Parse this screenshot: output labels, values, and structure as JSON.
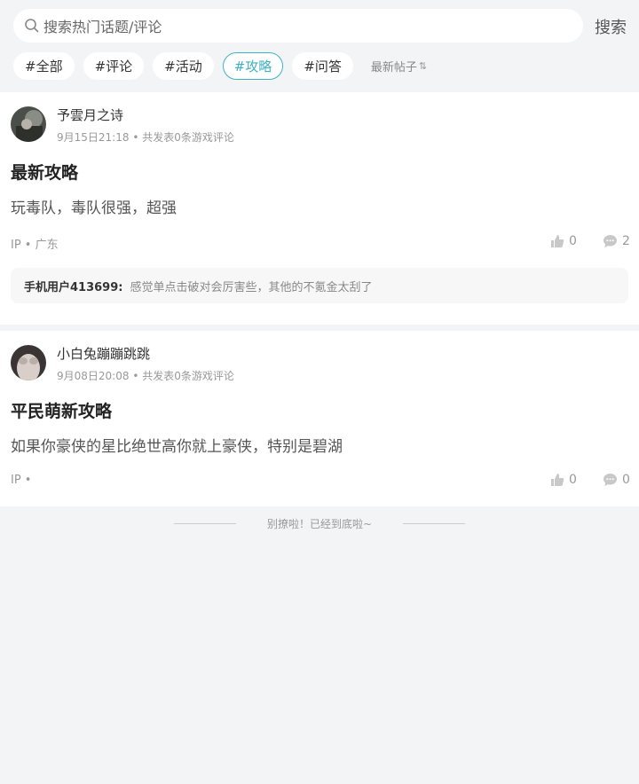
{
  "search": {
    "placeholder": "搜索热门话题/评论",
    "button": "搜索"
  },
  "tags": [
    {
      "label": "#全部"
    },
    {
      "label": "#评论"
    },
    {
      "label": "#活动"
    },
    {
      "label": "#攻略",
      "active": true
    },
    {
      "label": "#问答"
    }
  ],
  "sort": {
    "label": "最新帖子",
    "icon": "sort-arrows-icon"
  },
  "posts": [
    {
      "author": "予雲月之诗",
      "date": "9月15日21:18",
      "info": "共发表0条游戏评论",
      "title": "最新攻略",
      "content": "玩毒队，毒队很强，超强",
      "ip": "IP • 广东",
      "likes": "0",
      "comments": "2",
      "reply": {
        "user": "手机用户413699:",
        "text": "感觉单点击破对会厉害些，其他的不氪金太刮了"
      }
    },
    {
      "author": "小白兔蹦蹦跳跳",
      "date": "9月08日20:08",
      "info": "共发表0条游戏评论",
      "title": "平民萌新攻略",
      "content": "如果你豪侠的星比绝世高你就上豪侠，特别是碧湖",
      "ip": "IP •",
      "likes": "0",
      "comments": "0"
    }
  ],
  "footer": {
    "text": "别撩啦！已经到底啦~"
  },
  "colors": {
    "accent": "#3fb0c4",
    "background": "#f3f4f6"
  }
}
